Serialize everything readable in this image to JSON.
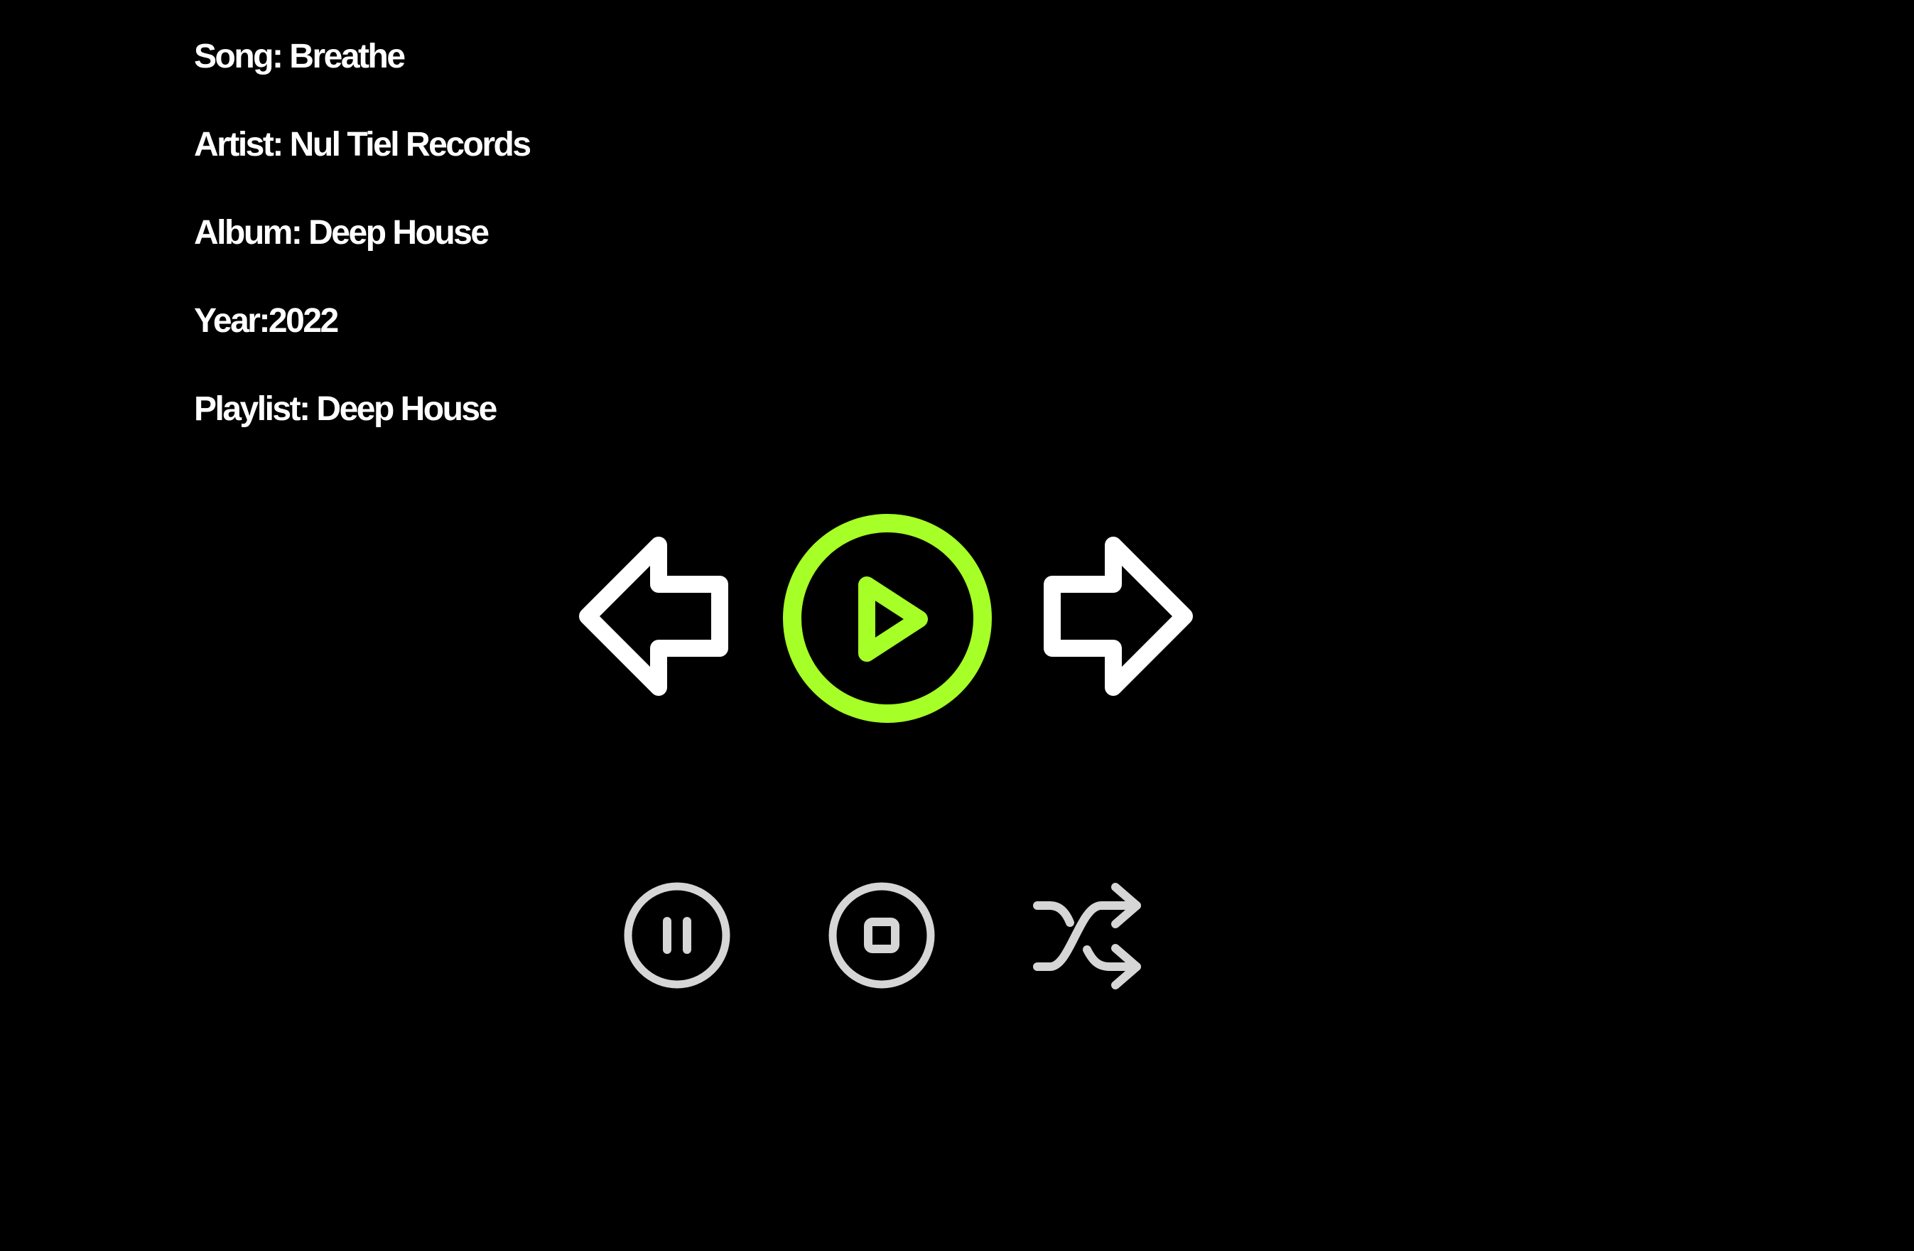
{
  "track_info": {
    "song": "Song: Breathe",
    "artist": "Artist: Nul Tiel Records",
    "album": "Album: Deep House",
    "year": "Year:2022",
    "playlist": "Playlist: Deep House"
  },
  "controls": {
    "primary": [
      {
        "name": "previous-button",
        "icon": "arrow-left-icon"
      },
      {
        "name": "play-button",
        "icon": "play-circle-icon"
      },
      {
        "name": "next-button",
        "icon": "arrow-right-icon"
      }
    ],
    "secondary": [
      {
        "name": "pause-button",
        "icon": "pause-circle-icon"
      },
      {
        "name": "stop-button",
        "icon": "stop-circle-icon"
      },
      {
        "name": "shuffle-button",
        "icon": "shuffle-icon"
      }
    ]
  },
  "colors": {
    "background": "#000000",
    "text": "#ffffff",
    "accent": "#a6ff26",
    "primary_icons": "#ffffff",
    "secondary_icons": "#d6d6d6"
  }
}
